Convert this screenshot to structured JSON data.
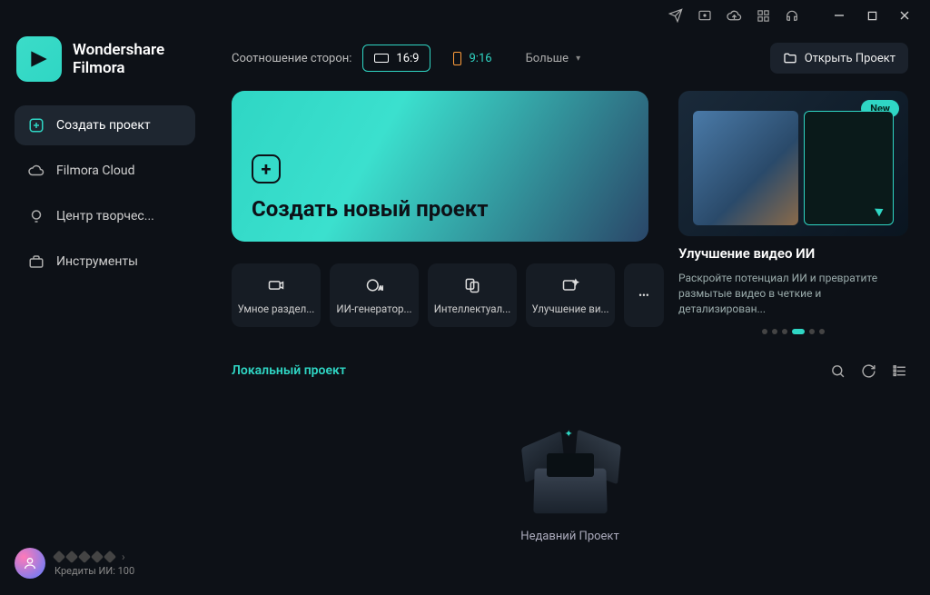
{
  "brand": {
    "line1": "Wondershare",
    "line2": "Filmora"
  },
  "nav": {
    "create": "Создать проект",
    "cloud": "Filmora Cloud",
    "creative": "Центр творчес...",
    "tools": "Инструменты"
  },
  "footer": {
    "credits": "Кредиты ИИ: 100"
  },
  "top": {
    "ratio_label": "Соотношение сторон:",
    "r169": "16:9",
    "r916": "9:16",
    "more": "Больше",
    "open": "Открыть Проект"
  },
  "hero": {
    "title": "Создать новый проект"
  },
  "feature": {
    "badge": "New",
    "title": "Улучшение видео ИИ",
    "desc": "Раскройте потенциал ИИ и превратите размытые видео в четкие и детализирован..."
  },
  "tools": {
    "t1": "Умное раздел...",
    "t2": "ИИ-генератор...",
    "t3": "Интеллектуал...",
    "t4": "Улучшение ви..."
  },
  "tabs": {
    "local": "Локальный проект"
  },
  "empty": {
    "recent": "Недавний Проект"
  }
}
